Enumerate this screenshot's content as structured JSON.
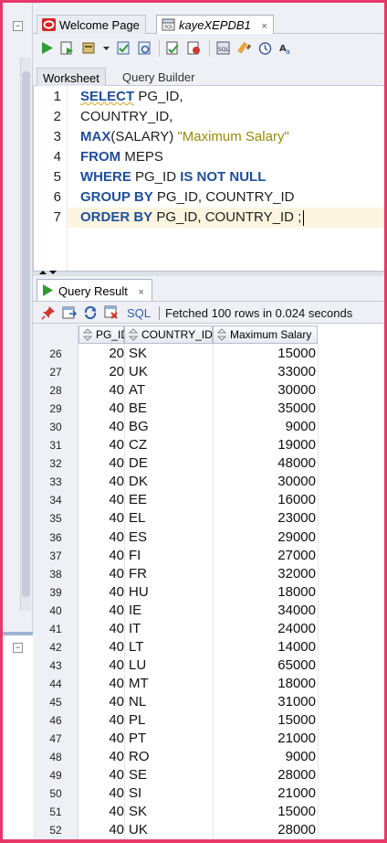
{
  "tabs": [
    {
      "label": "Welcome Page",
      "icon": "oracle-logo-icon"
    },
    {
      "label": "kayeXEPDB1",
      "icon": "sql-worksheet-icon",
      "close": "×"
    }
  ],
  "toolbar_icons": [
    "run-statement-icon",
    "run-script-icon",
    "autotrace-icon",
    "dropdown-icon",
    "commit-icon",
    "rollback-icon",
    "explain-plan-icon",
    "cancel-icon",
    "sql-tuning-icon",
    "clear-icon",
    "history-icon",
    "format-icon"
  ],
  "worksheet_tabs": [
    "Worksheet",
    "Query Builder"
  ],
  "editor": {
    "line_numbers": [
      "1",
      "2",
      "3",
      "4",
      "5",
      "6",
      "7"
    ],
    "lines": [
      {
        "kw": "SELECT",
        "rest": " PG_ID,"
      },
      {
        "rest": "COUNTRY_ID,"
      },
      {
        "fn": "MAX",
        "mid": "(SALARY) ",
        "str": "\"Maximum Salary\""
      },
      {
        "kw": "FROM",
        "rest": " MEPS"
      },
      {
        "kw": "WHERE",
        "mid": " PG_ID ",
        "kw2": "IS NOT NULL"
      },
      {
        "kw": "GROUP BY",
        "rest": " PG_ID, COUNTRY_ID"
      },
      {
        "kw": "ORDER BY",
        "rest": " PG_ID, COUNTRY_ID ;"
      }
    ]
  },
  "result": {
    "tab_label": "Query Result",
    "tab_close": "×",
    "sql_link": "SQL",
    "status": "Fetched 100 rows in 0.024 seconds",
    "columns": [
      "PG_ID",
      "COUNTRY_ID",
      "Maximum Salary"
    ],
    "rows": [
      [
        "26",
        "20",
        "SK",
        "15000"
      ],
      [
        "27",
        "20",
        "UK",
        "33000"
      ],
      [
        "28",
        "40",
        "AT",
        "30000"
      ],
      [
        "29",
        "40",
        "BE",
        "35000"
      ],
      [
        "30",
        "40",
        "BG",
        "9000"
      ],
      [
        "31",
        "40",
        "CZ",
        "19000"
      ],
      [
        "32",
        "40",
        "DE",
        "48000"
      ],
      [
        "33",
        "40",
        "DK",
        "30000"
      ],
      [
        "34",
        "40",
        "EE",
        "16000"
      ],
      [
        "35",
        "40",
        "EL",
        "23000"
      ],
      [
        "36",
        "40",
        "ES",
        "29000"
      ],
      [
        "37",
        "40",
        "FI",
        "27000"
      ],
      [
        "38",
        "40",
        "FR",
        "32000"
      ],
      [
        "39",
        "40",
        "HU",
        "18000"
      ],
      [
        "40",
        "40",
        "IE",
        "34000"
      ],
      [
        "41",
        "40",
        "IT",
        "24000"
      ],
      [
        "42",
        "40",
        "LT",
        "14000"
      ],
      [
        "43",
        "40",
        "LU",
        "65000"
      ],
      [
        "44",
        "40",
        "MT",
        "18000"
      ],
      [
        "45",
        "40",
        "NL",
        "31000"
      ],
      [
        "46",
        "40",
        "PL",
        "15000"
      ],
      [
        "47",
        "40",
        "PT",
        "21000"
      ],
      [
        "48",
        "40",
        "RO",
        "9000"
      ],
      [
        "49",
        "40",
        "SE",
        "28000"
      ],
      [
        "50",
        "40",
        "SI",
        "21000"
      ],
      [
        "51",
        "40",
        "SK",
        "15000"
      ],
      [
        "52",
        "40",
        "UK",
        "28000"
      ]
    ]
  },
  "colors": {
    "keyword": "#1f4f9e",
    "string": "#9a8a08",
    "current_line": "#fbf5e0",
    "sql_link": "#2d5eb3",
    "frame": "#e8386a"
  }
}
